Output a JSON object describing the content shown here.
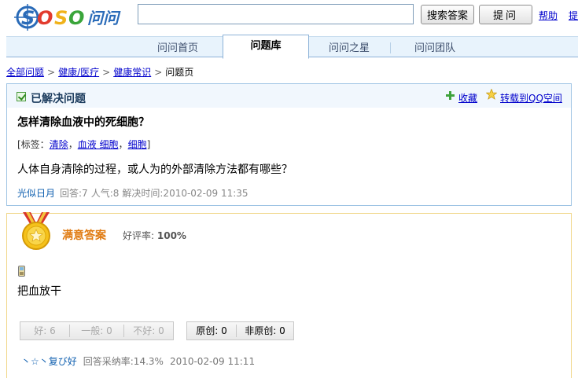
{
  "header": {
    "logo_text": "SOSO问问",
    "search_value": "",
    "search_button": "搜索答案",
    "ask_button": "提问",
    "help_link": "帮助",
    "more_link": "提"
  },
  "nav": {
    "tabs": [
      {
        "label": "问问首页",
        "active": false
      },
      {
        "label": "问题库",
        "active": true
      },
      {
        "label": "问问之星",
        "active": false
      },
      {
        "label": "问问团队",
        "active": false
      }
    ]
  },
  "breadcrumb": {
    "items": [
      "全部问题",
      "健康/医疗",
      "健康常识"
    ],
    "current": "问题页"
  },
  "question": {
    "status": "已解决问题",
    "favorite_label": "收藏",
    "share_label": "转载到QQ空间",
    "title": "怎样清除血液中的死细胞？",
    "tags_prefix": "[标签：",
    "tags": [
      "清除",
      "血液 细胞",
      "细胞"
    ],
    "tags_suffix": "]",
    "body": "人体自身清除的过程，或人为的外部清除方法都有哪些？",
    "asker": "光似日月",
    "answers": "回答:7",
    "popularity": "人气:8",
    "solved_time": "解决时间:2010-02-09 11:35"
  },
  "answer": {
    "title": "满意答案",
    "rating_label": "好评率:",
    "rating_value": "100%",
    "text": "把血放干",
    "votes": {
      "good": "好: 6",
      "normal": "一般: 0",
      "bad": "不好: 0",
      "original": "原创: 0",
      "non_original": "非原创: 0"
    },
    "answerer": "丶☆丶复び好",
    "adoption_rate": "回答采纳率:14.3%",
    "time": "2010-02-09 11:11"
  },
  "colors": {
    "link": "#0000cc",
    "nav_bg": "#e8f3fc",
    "accent_orange": "#e07a10",
    "solved_green": "#3fa33c"
  }
}
